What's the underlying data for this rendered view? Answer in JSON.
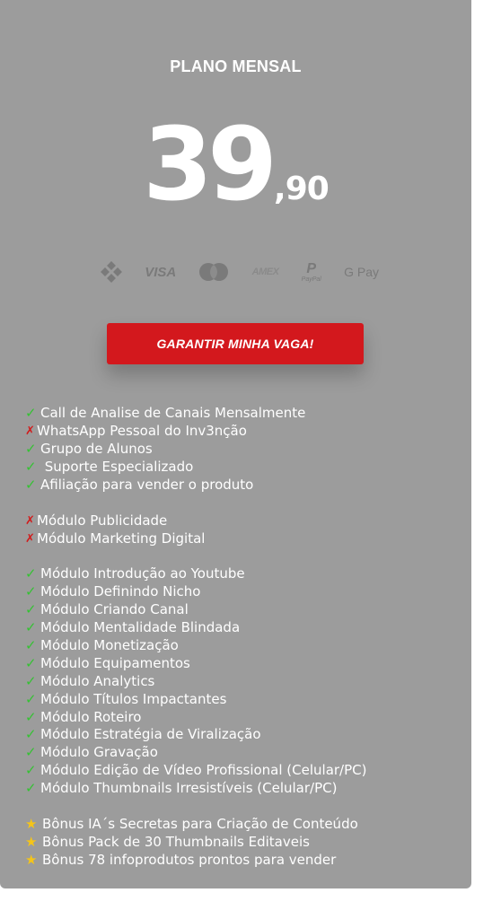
{
  "plan": {
    "name": "PLANO MENSAL",
    "price_integer": "39",
    "price_decimal": ",90"
  },
  "payment_methods": {
    "visa_label": "VISA",
    "amex_label": "AMEX",
    "paypal_label": "PayPal",
    "gpay_label": "G Pay",
    "icons": [
      "pix-icon",
      "visa-icon",
      "mastercard-icon",
      "amex-icon",
      "paypal-icon",
      "google-pay-icon"
    ]
  },
  "cta": {
    "label": "GARANTIR MINHA VAGA!"
  },
  "colors": {
    "card_background": "#9c9c9c",
    "cta_background": "#d3181d",
    "check": "#35c233",
    "cross": "#d31a1a",
    "star": "#f5c518"
  },
  "features": {
    "group1": [
      {
        "mark": "✓",
        "text": "Call de Analise de Canais Mensalmente"
      },
      {
        "mark": "✗",
        "text": "WhatsApp Pessoal do Inv3nção"
      },
      {
        "mark": "✓",
        "text": "Grupo de Alunos"
      },
      {
        "mark": "✓",
        "text": " Suporte Especializado"
      },
      {
        "mark": "✓",
        "text": "Afiliação para vender o produto"
      }
    ],
    "group2": [
      {
        "mark": "✗",
        "text": "Módulo Publicidade"
      },
      {
        "mark": "✗",
        "text": "Módulo Marketing Digital"
      }
    ],
    "group3": [
      {
        "mark": "✓",
        "text": "Módulo Introdução ao Youtube"
      },
      {
        "mark": "✓",
        "text": "Módulo Definindo Nicho"
      },
      {
        "mark": "✓",
        "text": "Módulo Criando Canal"
      },
      {
        "mark": "✓",
        "text": "Módulo Mentalidade Blindada"
      },
      {
        "mark": "✓",
        "text": "Módulo Monetização"
      },
      {
        "mark": "✓",
        "text": "Módulo Equipamentos"
      },
      {
        "mark": "✓",
        "text": "Módulo Analytics"
      },
      {
        "mark": "✓",
        "text": "Módulo Títulos Impactantes"
      },
      {
        "mark": "✓",
        "text": "Módulo Roteiro"
      },
      {
        "mark": "✓",
        "text": "Módulo Estratégia de Viralização"
      },
      {
        "mark": "✓",
        "text": "Módulo Gravação"
      },
      {
        "mark": "✓",
        "text": "Módulo Edição de Vídeo Profissional (Celular/PC)"
      },
      {
        "mark": "✓",
        "text": "Módulo Thumbnails Irresistíveis (Celular/PC)"
      }
    ],
    "group4": [
      {
        "mark": "★",
        "text": "Bônus IA´s Secretas para Criação de Conteúdo"
      },
      {
        "mark": "★",
        "text": "Bônus Pack de 30 Thumbnails Editaveis"
      },
      {
        "mark": "★",
        "text": "Bônus 78 infoprodutos prontos para vender"
      }
    ]
  }
}
